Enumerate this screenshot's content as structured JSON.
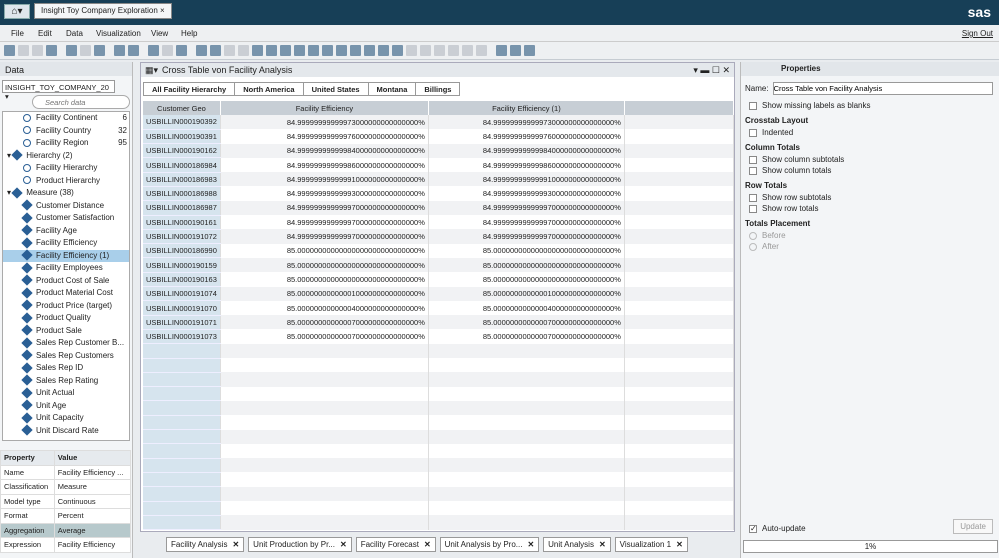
{
  "app": {
    "doc_tab": "Insight Toy Company Exploration",
    "logo": "sas",
    "sign_out": "Sign Out"
  },
  "menu": [
    "File",
    "Edit",
    "Data",
    "Visualization",
    "View",
    "Help"
  ],
  "data_panel": {
    "title": "Data",
    "source": "INSIGHT_TOY_COMPANY_20",
    "search_placeholder": "Search data",
    "items": [
      {
        "label": "Facility Continent",
        "count": "6",
        "type": "geo",
        "indent": 2
      },
      {
        "label": "Facility Country",
        "count": "32",
        "type": "geo",
        "indent": 2
      },
      {
        "label": "Facility Region",
        "count": "95",
        "type": "geo",
        "indent": 2
      },
      {
        "label": "Hierarchy (2)",
        "count": "",
        "type": "group",
        "indent": 0
      },
      {
        "label": "Facility Hierarchy",
        "count": "",
        "type": "hier",
        "indent": 2
      },
      {
        "label": "Product Hierarchy",
        "count": "",
        "type": "hier",
        "indent": 2
      },
      {
        "label": "Measure (38)",
        "count": "",
        "type": "group",
        "indent": 0
      },
      {
        "label": "Customer Distance",
        "count": "",
        "type": "measure",
        "indent": 2
      },
      {
        "label": "Customer Satisfaction",
        "count": "",
        "type": "measure",
        "indent": 2
      },
      {
        "label": "Facility Age",
        "count": "",
        "type": "measure",
        "indent": 2
      },
      {
        "label": "Facility Efficiency",
        "count": "",
        "type": "measure",
        "indent": 2
      },
      {
        "label": "Facility Efficiency (1)",
        "count": "",
        "type": "measure",
        "indent": 2,
        "selected": true
      },
      {
        "label": "Facility Employees",
        "count": "",
        "type": "measure",
        "indent": 2
      },
      {
        "label": "Product Cost of Sale",
        "count": "",
        "type": "measure",
        "indent": 2
      },
      {
        "label": "Product Material Cost",
        "count": "",
        "type": "measure",
        "indent": 2
      },
      {
        "label": "Product Price (target)",
        "count": "",
        "type": "measure",
        "indent": 2
      },
      {
        "label": "Product Quality",
        "count": "",
        "type": "measure",
        "indent": 2
      },
      {
        "label": "Product Sale",
        "count": "",
        "type": "measure",
        "indent": 2
      },
      {
        "label": "Sales Rep Customer B...",
        "count": "",
        "type": "measure",
        "indent": 2
      },
      {
        "label": "Sales Rep Customers",
        "count": "",
        "type": "measure",
        "indent": 2
      },
      {
        "label": "Sales Rep ID",
        "count": "",
        "type": "measure",
        "indent": 2
      },
      {
        "label": "Sales Rep Rating",
        "count": "",
        "type": "measure",
        "indent": 2
      },
      {
        "label": "Unit Actual",
        "count": "",
        "type": "measure",
        "indent": 2
      },
      {
        "label": "Unit Age",
        "count": "",
        "type": "measure",
        "indent": 2
      },
      {
        "label": "Unit Capacity",
        "count": "",
        "type": "measure",
        "indent": 2
      },
      {
        "label": "Unit Discard Rate",
        "count": "",
        "type": "measure",
        "indent": 2
      }
    ]
  },
  "properties_table": {
    "headers": [
      "Property",
      "Value"
    ],
    "rows": [
      [
        "Name",
        "Facility Efficiency ..."
      ],
      [
        "Classification",
        "Measure"
      ],
      [
        "Model type",
        "Continuous"
      ],
      [
        "Format",
        "Percent"
      ],
      [
        "Aggregation",
        "Average"
      ],
      [
        "Expression",
        "Facility Efficiency"
      ]
    ]
  },
  "viz": {
    "title": "Cross Table von Facility Analysis",
    "crumbs": [
      "All Facility Hierarchy",
      "North America",
      "United States",
      "Montana",
      "Billings"
    ],
    "headers": [
      "Customer Geo",
      "Facility Efficiency",
      "Facility Efficiency (1)"
    ],
    "rows": [
      [
        "USBILLIN000190392",
        "84.99999999999973000000000000000%"
      ],
      [
        "USBILLIN000190391",
        "84.99999999999976000000000000000%"
      ],
      [
        "USBILLIN000190162",
        "84.99999999999984000000000000000%"
      ],
      [
        "USBILLIN000186984",
        "84.99999999999986000000000000000%"
      ],
      [
        "USBILLIN000186983",
        "84.99999999999991000000000000000%"
      ],
      [
        "USBILLIN000186988",
        "84.99999999999993000000000000000%"
      ],
      [
        "USBILLIN000186987",
        "84.99999999999997000000000000000%"
      ],
      [
        "USBILLIN000190161",
        "84.99999999999997000000000000000%"
      ],
      [
        "USBILLIN000191072",
        "84.99999999999997000000000000000%"
      ],
      [
        "USBILLIN000186990",
        "85.00000000000000000000000000000%"
      ],
      [
        "USBILLIN000190159",
        "85.00000000000000000000000000000%"
      ],
      [
        "USBILLIN000190163",
        "85.00000000000000000000000000000%"
      ],
      [
        "USBILLIN000191074",
        "85.00000000000001000000000000000%"
      ],
      [
        "USBILLIN000191070",
        "85.00000000000004000000000000000%"
      ],
      [
        "USBILLIN000191071",
        "85.00000000000007000000000000000%"
      ],
      [
        "USBILLIN000191073",
        "85.00000000000007000000000000000%"
      ]
    ]
  },
  "right": {
    "title": "Properties",
    "name_label": "Name:",
    "name_value": "Cross Table von Facility Analysis",
    "show_missing": "Show missing labels as blanks",
    "crosstab_layout": "Crosstab Layout",
    "indented": "Indented",
    "column_totals": "Column Totals",
    "show_col_sub": "Show column subtotals",
    "show_col_tot": "Show column totals",
    "row_totals": "Row Totals",
    "show_row_sub": "Show row subtotals",
    "show_row_tot": "Show row totals",
    "totals_placement": "Totals Placement",
    "before": "Before",
    "after": "After",
    "auto_update": "Auto-update",
    "update": "Update",
    "progress": "1%"
  },
  "tabs": [
    "Facility Analysis",
    "Unit Production by Pr...",
    "Facility Forecast",
    "Unit Analysis by Pro...",
    "Unit Analysis",
    "Visualization 1"
  ]
}
